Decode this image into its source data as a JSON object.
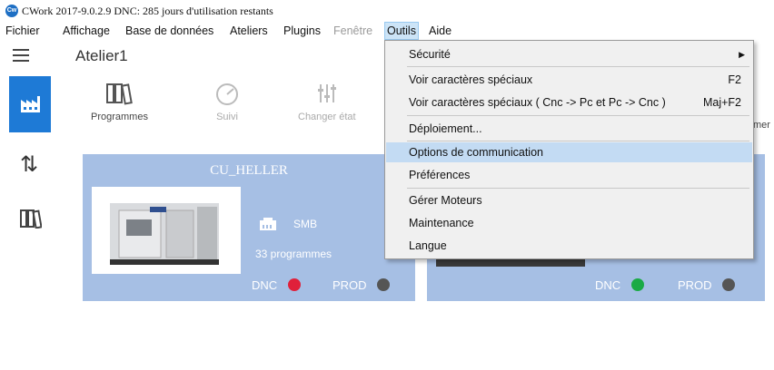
{
  "window": {
    "title": "CWork 2017-9.0.2.9 DNC: 285 jours d'utilisation restants",
    "logo_text": "Cw"
  },
  "menubar": {
    "fichier": "Fichier",
    "affichage": "Affichage",
    "base": "Base de données",
    "ateliers": "Ateliers",
    "plugins": "Plugins",
    "fenetre": "Fenêtre",
    "outils": "Outils",
    "aide": "Aide"
  },
  "workshop": {
    "title": "Atelier1"
  },
  "toolbar": {
    "programmes": "Programmes",
    "suivi": "Suivi",
    "changer_etat": "Changer état",
    "cut_label": "mer"
  },
  "cards": [
    {
      "title": "CU_HELLER",
      "protocol": "SMB",
      "programs": "33 programmes",
      "dnc_label": "DNC",
      "dnc_color": "#e0203a",
      "prod_label": "PROD",
      "prod_color": "#555555"
    },
    {
      "dnc_label": "DNC",
      "dnc_color": "#1aaa45",
      "prod_label": "PROD",
      "prod_color": "#555555"
    }
  ],
  "outils_menu": {
    "items": [
      {
        "label": "Sécurité",
        "shortcut": "",
        "submenu": true
      },
      {
        "label": "Voir caractères spéciaux",
        "shortcut": "F2"
      },
      {
        "label": "Voir caractères spéciaux ( Cnc -> Pc et Pc -> Cnc )",
        "shortcut": "Maj+F2"
      },
      {
        "label": "Déploiement...",
        "shortcut": ""
      },
      {
        "label": "Options de communication",
        "shortcut": "",
        "highlighted": true
      },
      {
        "label": "Préférences",
        "shortcut": ""
      },
      {
        "label": "Gérer Moteurs",
        "shortcut": ""
      },
      {
        "label": "Maintenance",
        "shortcut": ""
      },
      {
        "label": "Langue",
        "shortcut": ""
      }
    ],
    "submenu_arrow": "▶"
  },
  "colors": {
    "nav_active": "#1e7ad6",
    "card_bg": "#a6bfe4",
    "menu_highlight": "#c3dbf3"
  }
}
